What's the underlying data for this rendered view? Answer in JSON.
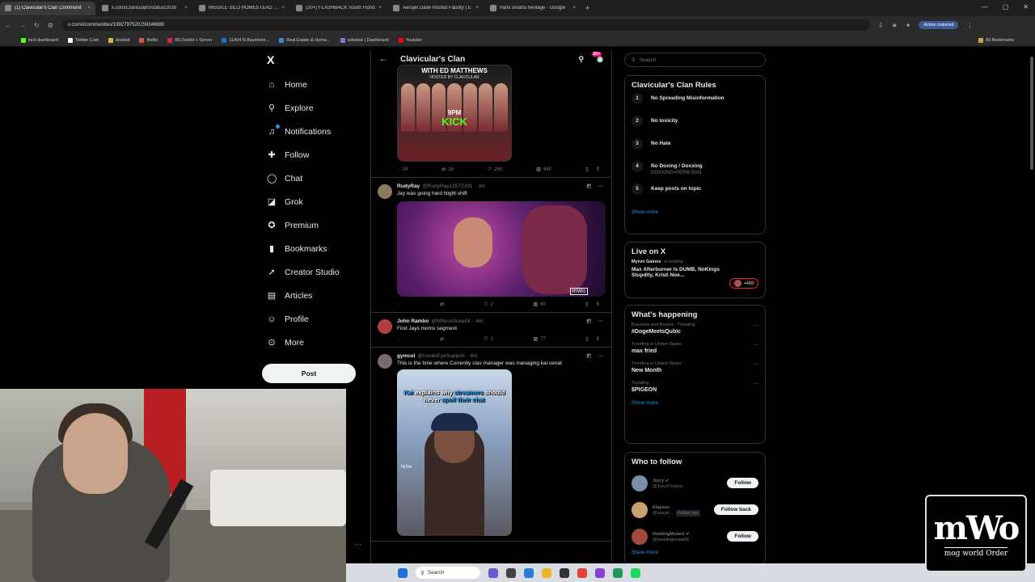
{
  "browser": {
    "tabs": [
      {
        "title": "(1) Clavicular's Clan Communit",
        "active": true
      },
      {
        "title": "x.com/Clavicular0/status/2039",
        "active": false
      },
      {
        "title": "MISSILE SILO HOMESTEAD - G",
        "active": false
      },
      {
        "title": "(20+) FLASHBACK South Florid",
        "active": false
      },
      {
        "title": "Aerojet Dade Rocket Facility | E",
        "active": false
      },
      {
        "title": "frank sinatra heritage - Google",
        "active": false
      }
    ],
    "url": "x.com/i/communities/1992797520259346880",
    "action_required": "Action required",
    "bookmarks": [
      "kick dashboard",
      "Twitter Com",
      "kickbot",
      "Botfix",
      "IRLToolkit + Server",
      "11404 N Bayshore...",
      "Real Estate & Home...",
      "sidekick | Dashboard",
      "Youtube"
    ],
    "all_bookmarks": "All Bookmarks"
  },
  "nav": {
    "logo": "X",
    "items": [
      {
        "label": "Home",
        "icon": "home-icon",
        "glyph": "⌂"
      },
      {
        "label": "Explore",
        "icon": "search-icon",
        "glyph": "⚲"
      },
      {
        "label": "Notifications",
        "icon": "bell-icon",
        "glyph": "♫"
      },
      {
        "label": "Follow",
        "icon": "follow-icon",
        "glyph": "✚"
      },
      {
        "label": "Chat",
        "icon": "chat-icon",
        "glyph": "◯"
      },
      {
        "label": "Grok",
        "icon": "grok-icon",
        "glyph": "◪"
      },
      {
        "label": "Premium",
        "icon": "premium-icon",
        "glyph": "✪"
      },
      {
        "label": "Bookmarks",
        "icon": "bookmark-icon",
        "glyph": "▮"
      },
      {
        "label": "Creator Studio",
        "icon": "rocket-icon",
        "glyph": "➚"
      },
      {
        "label": "Articles",
        "icon": "article-icon",
        "glyph": "▤"
      },
      {
        "label": "Profile",
        "icon": "person-icon",
        "glyph": "☺"
      },
      {
        "label": "More",
        "icon": "more-icon",
        "glyph": "⊙"
      }
    ],
    "post": "Post"
  },
  "community": {
    "title": "Clavicular's Clan",
    "badge": "20+"
  },
  "tweets": [
    {
      "media_line1": "WITH ED MATTHEWS",
      "media_line2": "HOSTED BY CLAVICULAR",
      "media_time": "9PM",
      "media_brand": "KICK",
      "replies": "24",
      "reposts": "16",
      "likes": "260",
      "views": "44K"
    },
    {
      "name": "RudyRay",
      "handle": "@RudyRay12572391",
      "time": "· 3m",
      "text": "Jay was going hard Night shift",
      "watermark": "mWo",
      "replies": "",
      "reposts": "",
      "likes": "2",
      "views": "69"
    },
    {
      "name": "John Rambo",
      "handle": "@MItesAboveAll",
      "time": "· 4m",
      "text": "Find Jays moms segment",
      "replies": "",
      "reposts": "",
      "likes": "1",
      "views": "77"
    },
    {
      "name": "gymcel",
      "handle": "@UnderEyeSupport",
      "time": "· 6m",
      "text": "This is the time where Currently clav manager was managing kai cenat",
      "caption_parts": [
        "Kai",
        " explains why ",
        "streamers",
        " should never ",
        "spoil their chat"
      ],
      "tiktok": "TikTok"
    }
  ],
  "search": {
    "placeholder": "Search"
  },
  "rules": {
    "title": "Clavicular's Clan Rules",
    "items": [
      {
        "n": "1",
        "text": "No Spreading Misinformation",
        "sub": ""
      },
      {
        "n": "2",
        "text": "No toxicity",
        "sub": ""
      },
      {
        "n": "3",
        "text": "No Hate",
        "sub": ""
      },
      {
        "n": "4",
        "text": "No Doxing / Doxxing",
        "sub": "DOXXING=PERM BAN"
      },
      {
        "n": "5",
        "text": "Keep posts on topic",
        "sub": ""
      }
    ],
    "show_more": "Show more"
  },
  "live": {
    "title": "Live on X",
    "host": "Myron Gaines",
    "hosting": "is hosting",
    "text": "Max Afterburner Is DUMB, NoKings Stupdity, Kristi Noe...",
    "count": "+410"
  },
  "happening": {
    "title": "What's happening",
    "trends": [
      {
        "context": "Business and finance · Trending",
        "name": "#DogeMeetsQubic"
      },
      {
        "context": "Trending in United States",
        "name": "max fried"
      },
      {
        "context": "Trending in United States",
        "name": "New Month"
      },
      {
        "context": "Trending",
        "name": "$PIGEON"
      }
    ],
    "show_more": "Show more"
  },
  "who_to_follow": {
    "title": "Who to follow",
    "users": [
      {
        "name": "Juicy",
        "handle": "@JuicyFruityyy",
        "button": "Follow",
        "follows_you": ""
      },
      {
        "name": "Elapsus",
        "handle": "@ausyd...",
        "button": "Follow back",
        "follows_you": "Follows you"
      },
      {
        "name": "HowlingMutant",
        "handle": "@Howlingmutant8",
        "button": "Follow",
        "follows_you": ""
      }
    ],
    "show_more": "Show more"
  },
  "taskbar": {
    "search": "Search"
  },
  "overlay": {
    "big": "mWo",
    "small": "mog world Order"
  },
  "colors": {
    "accent": "#1d9bf0",
    "kick": "#53fc18",
    "live": "#f4212e",
    "background": "#000000"
  }
}
